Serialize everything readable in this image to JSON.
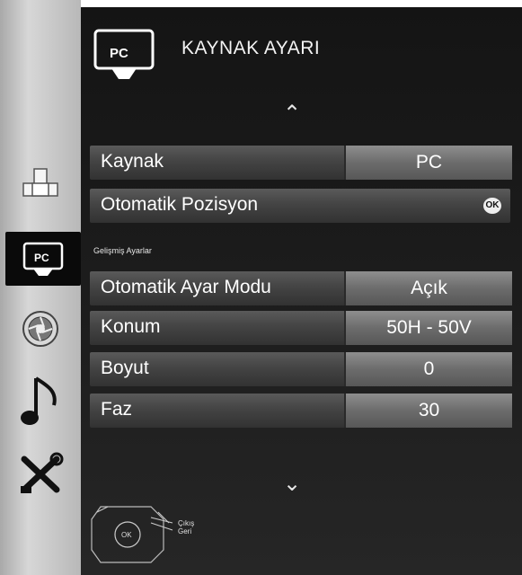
{
  "header": {
    "icon": "pc-icon",
    "icon_text": "PC",
    "title": "KAYNAK AYARI"
  },
  "sidebar": {
    "items": [
      {
        "name": "image-settings-icon",
        "active": false
      },
      {
        "name": "pc-icon",
        "label": "PC",
        "active": true
      },
      {
        "name": "aperture-icon",
        "active": false
      },
      {
        "name": "music-note-icon",
        "active": false
      },
      {
        "name": "tools-icon",
        "active": false
      }
    ]
  },
  "menu": {
    "kaynak": {
      "label": "Kaynak",
      "value": "PC"
    },
    "otomatik_pozisyon": {
      "label": "Otomatik Pozisyon",
      "badge": "OK"
    },
    "section_label": "Gelişmiş Ayarlar",
    "otomatik_ayar_modu": {
      "label": "Otomatik Ayar Modu",
      "value": "Açık"
    },
    "konum": {
      "label": "Konum",
      "value": "50H - 50V"
    },
    "boyut": {
      "label": "Boyut",
      "value": "0"
    },
    "faz": {
      "label": "Faz",
      "value": "30"
    }
  },
  "footer": {
    "ok": "OK",
    "exit": "Çıkış",
    "back": "Geri"
  },
  "colors": {
    "panel": "#1a1a1a",
    "row": "#444444",
    "value_cell": "#7a7a7a",
    "sidebar": "#c4c4c4"
  }
}
